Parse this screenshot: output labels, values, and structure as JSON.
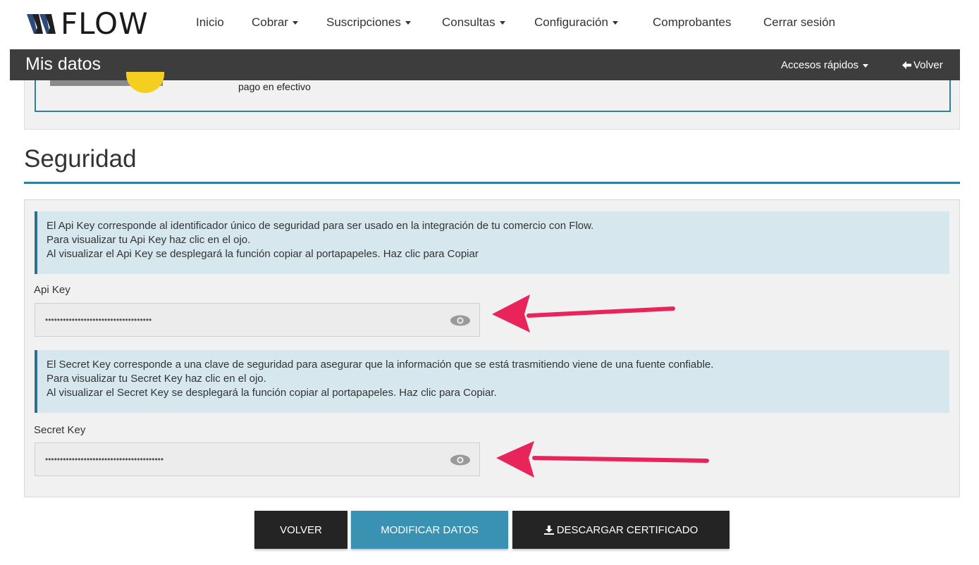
{
  "brand": {
    "name": "FLOW",
    "accent": "#3a92b2",
    "dark": "#3d3d3d",
    "pink": "#e8245a"
  },
  "nav": {
    "items": [
      {
        "label": "Inicio",
        "dropdown": false
      },
      {
        "label": "Cobrar",
        "dropdown": true
      },
      {
        "label": "Suscripciones",
        "dropdown": true
      },
      {
        "label": "Consultas",
        "dropdown": true
      },
      {
        "label": "Configuración",
        "dropdown": true
      },
      {
        "label": "Comprobantes",
        "dropdown": false
      },
      {
        "label": "Cerrar sesión",
        "dropdown": false
      }
    ]
  },
  "subheader": {
    "title": "Mis datos",
    "quick_access": "Accesos rápidos",
    "back_icon": "arrow-left-icon",
    "back": "Volver"
  },
  "previous_section": {
    "text": "pago en efectivo"
  },
  "security": {
    "title": "Seguridad",
    "api_info": [
      "El Api Key corresponde al identificador único de seguridad para ser usado en la integración de tu comercio con Flow.",
      "Para visualizar tu Api Key haz clic en el ojo.",
      "Al visualizar el Api Key se desplegará la función copiar al portapapeles. Haz clic para Copiar"
    ],
    "api_label": "Api Key",
    "api_value": "••••••••••••••••••••••••••••••••••••",
    "secret_info": [
      "El Secret Key corresponde a una clave de seguridad para asegurar que la información que se está trasmitiendo viene de una fuente confiable.",
      "Para visualizar tu Secret Key haz clic en el ojo.",
      "Al visualizar el Secret Key se desplegará la función copiar al portapapeles. Haz clic para Copiar."
    ],
    "secret_label": "Secret Key",
    "secret_value": "••••••••••••••••••••••••••••••••••••••••",
    "eye_icon": "eye-icon"
  },
  "buttons": {
    "back": "VOLVER",
    "modify": "MODIFICAR DATOS",
    "download_icon": "download-icon",
    "download": "DESCARGAR CERTIFICADO"
  }
}
